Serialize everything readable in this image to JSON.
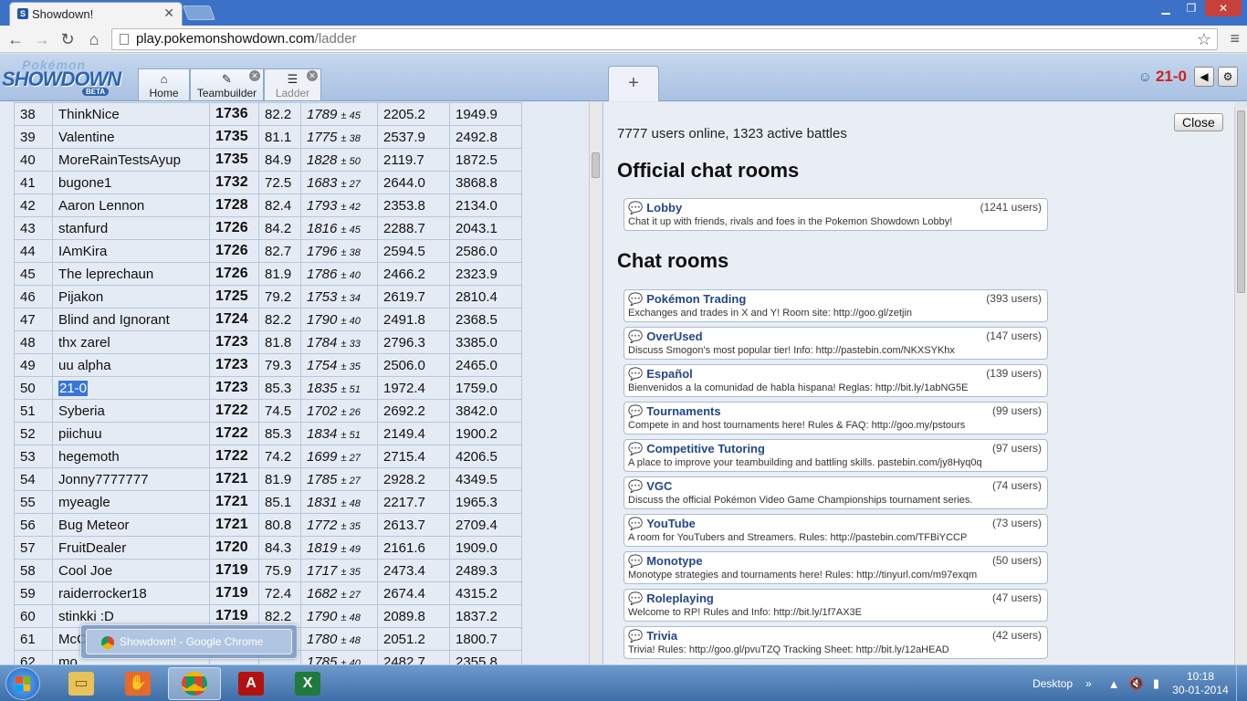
{
  "browser": {
    "tab_title": "Showdown!",
    "url_host": "play.pokemonshowdown.com",
    "url_path": "/ladder"
  },
  "header": {
    "logo_top": "Pokémon",
    "logo_main": "SHOWDOWN",
    "logo_badge": "BETA",
    "tabs": [
      {
        "label": "Home",
        "icon": "home-icon"
      },
      {
        "label": "Teambuilder",
        "icon": "edit-icon"
      },
      {
        "label": "Ladder",
        "icon": "list-icon"
      }
    ],
    "new_tab_label": "+",
    "username": "21-0"
  },
  "ladder": {
    "rows": [
      {
        "rank": "38",
        "name": "ThinkNice",
        "elo": "1736",
        "gxe": "82.2",
        "glicko": "1789",
        "dev": "± 45",
        "c6": "2205.2",
        "c7": "1949.9"
      },
      {
        "rank": "39",
        "name": "Valentine",
        "elo": "1735",
        "gxe": "81.1",
        "glicko": "1775",
        "dev": "± 38",
        "c6": "2537.9",
        "c7": "2492.8"
      },
      {
        "rank": "40",
        "name": "MoreRainTestsAyup",
        "elo": "1735",
        "gxe": "84.9",
        "glicko": "1828",
        "dev": "± 50",
        "c6": "2119.7",
        "c7": "1872.5"
      },
      {
        "rank": "41",
        "name": "bugone1",
        "elo": "1732",
        "gxe": "72.5",
        "glicko": "1683",
        "dev": "± 27",
        "c6": "2644.0",
        "c7": "3868.8"
      },
      {
        "rank": "42",
        "name": "Aaron Lennon",
        "elo": "1728",
        "gxe": "82.4",
        "glicko": "1793",
        "dev": "± 42",
        "c6": "2353.8",
        "c7": "2134.0"
      },
      {
        "rank": "43",
        "name": "stanfurd",
        "elo": "1726",
        "gxe": "84.2",
        "glicko": "1816",
        "dev": "± 45",
        "c6": "2288.7",
        "c7": "2043.1"
      },
      {
        "rank": "44",
        "name": "IAmKira",
        "elo": "1726",
        "gxe": "82.7",
        "glicko": "1796",
        "dev": "± 38",
        "c6": "2594.5",
        "c7": "2586.0"
      },
      {
        "rank": "45",
        "name": "The leprechaun",
        "elo": "1726",
        "gxe": "81.9",
        "glicko": "1786",
        "dev": "± 40",
        "c6": "2466.2",
        "c7": "2323.9"
      },
      {
        "rank": "46",
        "name": "Pijakon",
        "elo": "1725",
        "gxe": "79.2",
        "glicko": "1753",
        "dev": "± 34",
        "c6": "2619.7",
        "c7": "2810.4"
      },
      {
        "rank": "47",
        "name": "Blind and Ignorant",
        "elo": "1724",
        "gxe": "82.2",
        "glicko": "1790",
        "dev": "± 40",
        "c6": "2491.8",
        "c7": "2368.5"
      },
      {
        "rank": "48",
        "name": "thx zarel",
        "elo": "1723",
        "gxe": "81.8",
        "glicko": "1784",
        "dev": "± 33",
        "c6": "2796.3",
        "c7": "3385.0"
      },
      {
        "rank": "49",
        "name": "uu alpha",
        "elo": "1723",
        "gxe": "79.3",
        "glicko": "1754",
        "dev": "± 35",
        "c6": "2506.0",
        "c7": "2465.0"
      },
      {
        "rank": "50",
        "name": "21-0",
        "elo": "1723",
        "gxe": "85.3",
        "glicko": "1835",
        "dev": "± 51",
        "c6": "1972.4",
        "c7": "1759.0"
      },
      {
        "rank": "51",
        "name": "Syberia",
        "elo": "1722",
        "gxe": "74.5",
        "glicko": "1702",
        "dev": "± 26",
        "c6": "2692.2",
        "c7": "3842.0"
      },
      {
        "rank": "52",
        "name": "piichuu",
        "elo": "1722",
        "gxe": "85.3",
        "glicko": "1834",
        "dev": "± 51",
        "c6": "2149.4",
        "c7": "1900.2"
      },
      {
        "rank": "53",
        "name": "hegemoth",
        "elo": "1722",
        "gxe": "74.2",
        "glicko": "1699",
        "dev": "± 27",
        "c6": "2715.4",
        "c7": "4206.5"
      },
      {
        "rank": "54",
        "name": "Jonny7777777",
        "elo": "1721",
        "gxe": "81.9",
        "glicko": "1785",
        "dev": "± 27",
        "c6": "2928.2",
        "c7": "4349.5"
      },
      {
        "rank": "55",
        "name": "myeagle",
        "elo": "1721",
        "gxe": "85.1",
        "glicko": "1831",
        "dev": "± 48",
        "c6": "2217.7",
        "c7": "1965.3"
      },
      {
        "rank": "56",
        "name": "Bug Meteor",
        "elo": "1721",
        "gxe": "80.8",
        "glicko": "1772",
        "dev": "± 35",
        "c6": "2613.7",
        "c7": "2709.4"
      },
      {
        "rank": "57",
        "name": "FruitDealer",
        "elo": "1720",
        "gxe": "84.3",
        "glicko": "1819",
        "dev": "± 49",
        "c6": "2161.6",
        "c7": "1909.0"
      },
      {
        "rank": "58",
        "name": "Cool Joe",
        "elo": "1719",
        "gxe": "75.9",
        "glicko": "1717",
        "dev": "± 35",
        "c6": "2473.4",
        "c7": "2489.3"
      },
      {
        "rank": "59",
        "name": "raiderrocker18",
        "elo": "1719",
        "gxe": "72.4",
        "glicko": "1682",
        "dev": "± 27",
        "c6": "2674.4",
        "c7": "4315.2"
      },
      {
        "rank": "60",
        "name": "stinkki :D",
        "elo": "1719",
        "gxe": "82.2",
        "glicko": "1790",
        "dev": "± 48",
        "c6": "2089.8",
        "c7": "1837.2"
      },
      {
        "rank": "61",
        "name": "McC",
        "elo": "",
        "gxe": "",
        "glicko": "1780",
        "dev": "± 48",
        "c6": "2051.2",
        "c7": "1800.7"
      },
      {
        "rank": "62",
        "name": "mo",
        "elo": "",
        "gxe": "",
        "glicko": "1785",
        "dev": "± 40",
        "c6": "2482.7",
        "c7": "2355.8"
      }
    ]
  },
  "rooms_panel": {
    "close_label": "Close",
    "online_text": "7777 users online, 1323 active battles",
    "official_heading": "Official chat rooms",
    "official_rooms": [
      {
        "name": "Lobby",
        "users": "(1241 users)",
        "desc": "Chat it up with friends, rivals and foes in the Pokemon Showdown Lobby!"
      }
    ],
    "chat_heading": "Chat rooms",
    "chat_rooms": [
      {
        "name": "Pokémon Trading",
        "users": "(393 users)",
        "desc": "Exchanges and trades in X and Y! Room site: http://goo.gl/zetjin"
      },
      {
        "name": "OverUsed",
        "users": "(147 users)",
        "desc": "Discuss Smogon's most popular tier! Info: http://pastebin.com/NKXSYKhx"
      },
      {
        "name": "Español",
        "users": "(139 users)",
        "desc": "Bienvenidos a la comunidad de habla hispana! Reglas: http://bit.ly/1abNG5E"
      },
      {
        "name": "Tournaments",
        "users": "(99 users)",
        "desc": "Compete in and host tournaments here! Rules & FAQ: http://goo.my/pstours"
      },
      {
        "name": "Competitive Tutoring",
        "users": "(97 users)",
        "desc": "A place to improve your teambuilding and battling skills. pastebin.com/jy8Hyq0q"
      },
      {
        "name": "VGC",
        "users": "(74 users)",
        "desc": "Discuss the official Pokémon Video Game Championships tournament series."
      },
      {
        "name": "YouTube",
        "users": "(73 users)",
        "desc": "A room for YouTubers and Streamers. Rules: http://pastebin.com/TFBiYCCP"
      },
      {
        "name": "Monotype",
        "users": "(50 users)",
        "desc": "Monotype strategies and tournaments here! Rules: http://tinyurl.com/m97exqm"
      },
      {
        "name": "Roleplaying",
        "users": "(47 users)",
        "desc": "Welcome to RP! Rules and Info: http://bit.ly/1f7AX3E"
      },
      {
        "name": "Trivia",
        "users": "(42 users)",
        "desc": "Trivia! Rules: http://goo.gl/pvuTZQ Tracking Sheet: http://bit.ly/12aHEAD"
      }
    ]
  },
  "taskbar": {
    "preview_title": "Showdown! - Google Chrome",
    "desktop_label": "Desktop",
    "time": "10:18",
    "date": "30-01-2014",
    "apps": [
      "explorer-icon",
      "media-icon",
      "chrome-icon",
      "acrobat-icon",
      "excel-icon"
    ]
  }
}
